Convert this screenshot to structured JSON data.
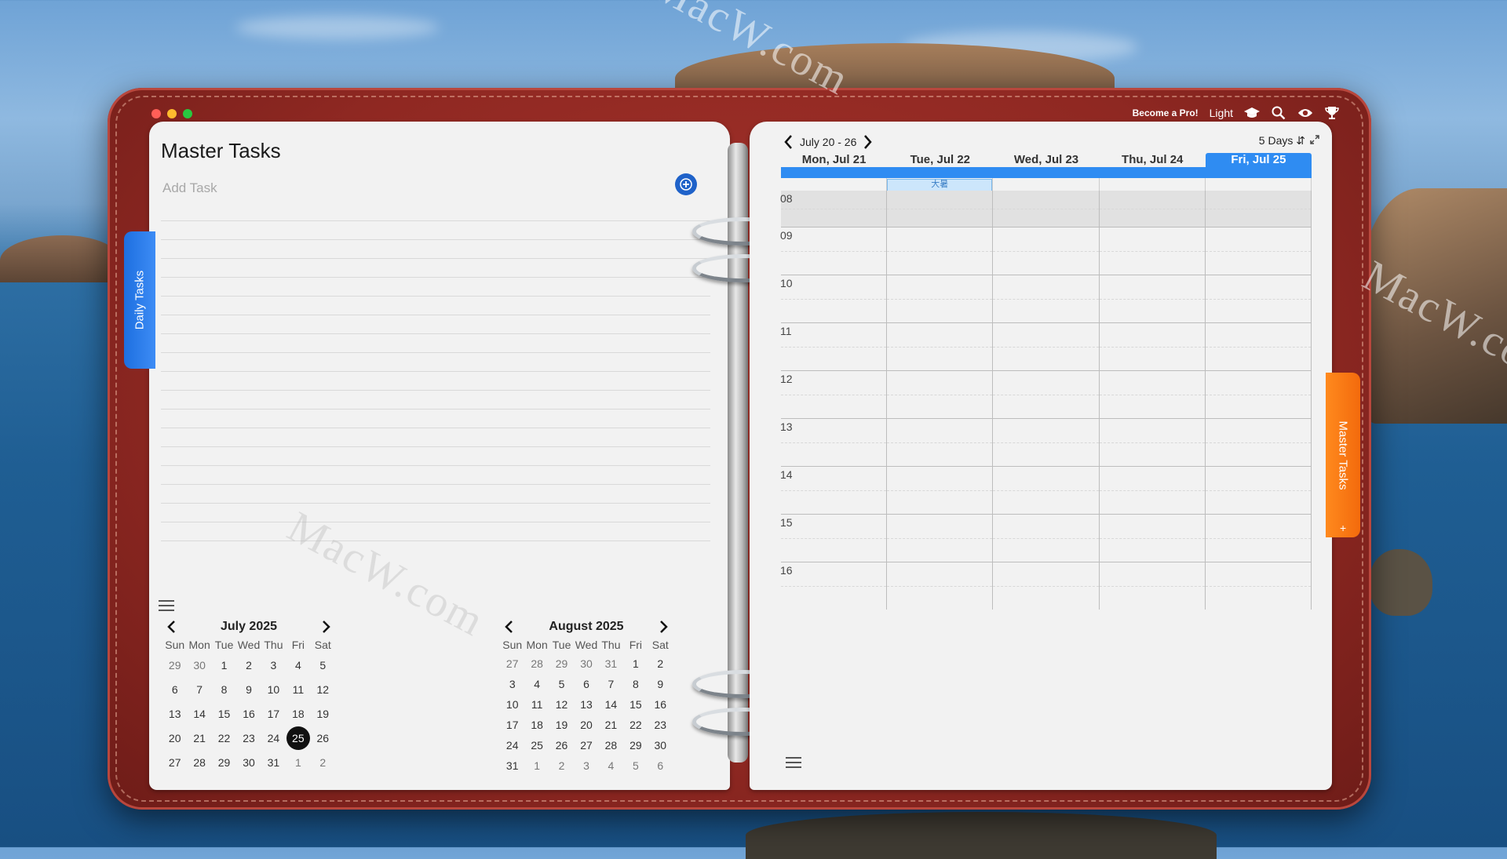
{
  "app": {
    "become_pro": "Become a Pro!",
    "theme": "Light",
    "icons": [
      "graduation-cap-icon",
      "search-icon",
      "eye-icon",
      "trophy-icon"
    ]
  },
  "side_tabs": {
    "left": "Daily Tasks",
    "right": "Master Tasks",
    "right_add": "+"
  },
  "master_tasks": {
    "title": "Master Tasks",
    "add_placeholder": "Add Task",
    "line_count": 18
  },
  "mini_calendars": [
    {
      "title": "July 2025",
      "dow": [
        "Sun",
        "Mon",
        "Tue",
        "Wed",
        "Thu",
        "Fri",
        "Sat"
      ],
      "weeks": [
        [
          "29",
          "30",
          "1",
          "2",
          "3",
          "4",
          "5"
        ],
        [
          "6",
          "7",
          "8",
          "9",
          "10",
          "11",
          "12"
        ],
        [
          "13",
          "14",
          "15",
          "16",
          "17",
          "18",
          "19"
        ],
        [
          "20",
          "21",
          "22",
          "23",
          "24",
          "25",
          "26"
        ],
        [
          "27",
          "28",
          "29",
          "30",
          "31",
          "1",
          "2"
        ]
      ],
      "other_month": [
        [
          0,
          0
        ],
        [
          0,
          1
        ],
        [
          4,
          5
        ],
        [
          4,
          6
        ]
      ],
      "today": [
        3,
        5
      ]
    },
    {
      "title": "August 2025",
      "dow": [
        "Sun",
        "Mon",
        "Tue",
        "Wed",
        "Thu",
        "Fri",
        "Sat"
      ],
      "weeks": [
        [
          "27",
          "28",
          "29",
          "30",
          "31",
          "1",
          "2"
        ],
        [
          "3",
          "4",
          "5",
          "6",
          "7",
          "8",
          "9"
        ],
        [
          "10",
          "11",
          "12",
          "13",
          "14",
          "15",
          "16"
        ],
        [
          "17",
          "18",
          "19",
          "20",
          "21",
          "22",
          "23"
        ],
        [
          "24",
          "25",
          "26",
          "27",
          "28",
          "29",
          "30"
        ],
        [
          "31",
          "1",
          "2",
          "3",
          "4",
          "5",
          "6"
        ]
      ],
      "other_month": [
        [
          0,
          0
        ],
        [
          0,
          1
        ],
        [
          0,
          2
        ],
        [
          0,
          3
        ],
        [
          0,
          4
        ],
        [
          5,
          1
        ],
        [
          5,
          2
        ],
        [
          5,
          3
        ],
        [
          5,
          4
        ],
        [
          5,
          5
        ],
        [
          5,
          6
        ]
      ],
      "today": null
    }
  ],
  "week_view": {
    "range": "July 20 -  26",
    "view_mode": "5 Days",
    "days": [
      "Mon, Jul 21",
      "Tue, Jul 22",
      "Wed, Jul 23",
      "Thu, Jul 24",
      "Fri, Jul 25"
    ],
    "selected_day_index": 4,
    "holiday": {
      "day_index": 1,
      "label": "大暑"
    },
    "hours": [
      "08",
      "09",
      "10",
      "11",
      "12",
      "13",
      "14",
      "15",
      "16"
    ]
  },
  "colors": {
    "accent": "#2f8cf2",
    "daily_tab": "#2f7ff0",
    "master_tab": "#f7770f",
    "leather": "#8f2822"
  },
  "watermark": "MacW.com"
}
